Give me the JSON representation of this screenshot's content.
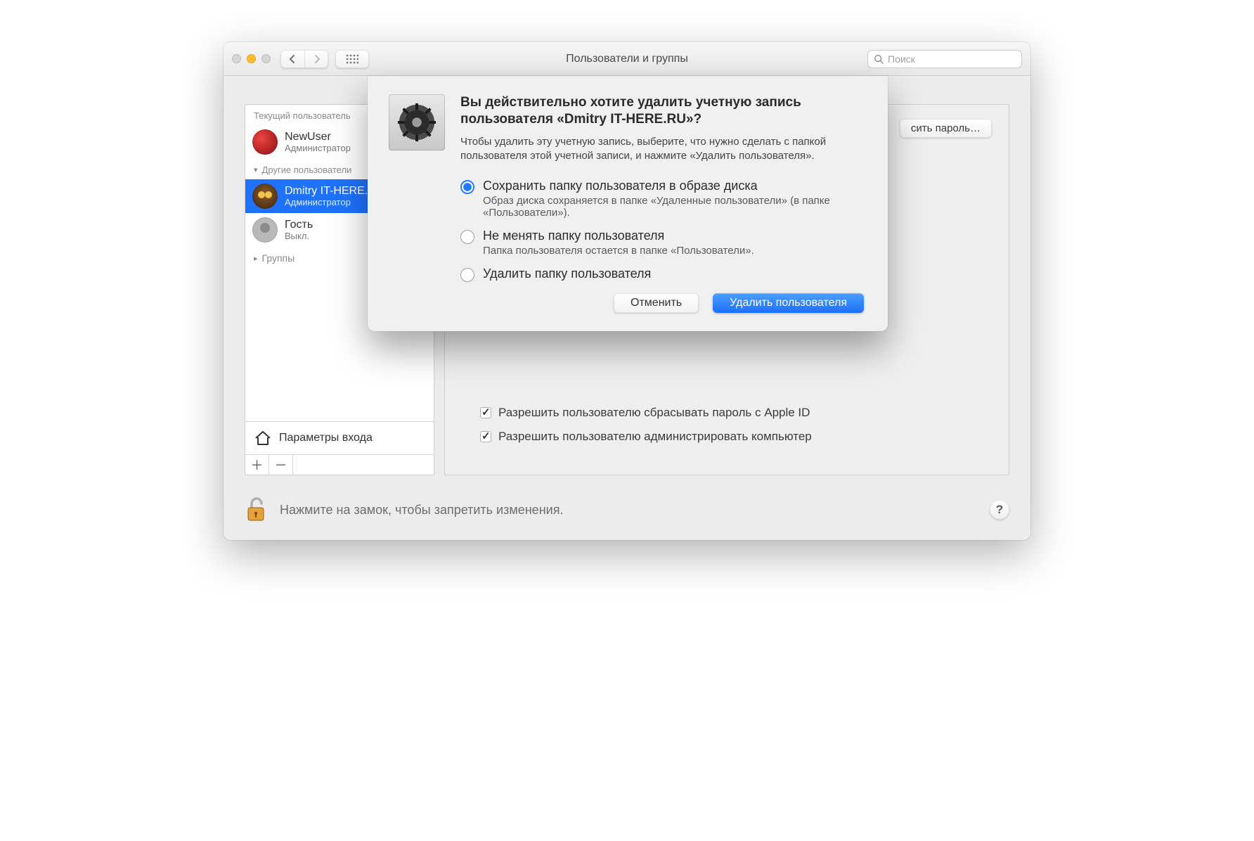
{
  "window": {
    "title": "Пользователи и группы"
  },
  "search": {
    "placeholder": "Поиск"
  },
  "sidebar": {
    "current_header": "Текущий пользователь",
    "others_header": "Другие пользователи",
    "groups_header": "Группы",
    "login_options": "Параметры входа",
    "users": [
      {
        "name": "NewUser",
        "role": "Администратор"
      },
      {
        "name": "Dmitry IT-HERE.RU",
        "role": "Администратор"
      },
      {
        "name": "Гость",
        "role": "Выкл."
      }
    ]
  },
  "main": {
    "reset_password_button": "сить пароль…",
    "checks": [
      "Разрешить пользователю сбрасывать пароль с Apple ID",
      "Разрешить пользователю администрировать компьютер"
    ]
  },
  "lock_hint": "Нажмите на замок, чтобы запретить изменения.",
  "help": "?",
  "dialog": {
    "title": "Вы действительно хотите удалить учетную запись пользователя «Dmitry IT-HERE.RU»?",
    "desc": "Чтобы удалить эту учетную запись, выберите, что нужно сделать с папкой пользователя этой учетной записи, и нажмите «Удалить пользователя».",
    "options": [
      {
        "label": "Сохранить папку пользователя в образе диска",
        "sub": "Образ диска сохраняется в папке «Удаленные пользователи» (в папке «Пользователи»)."
      },
      {
        "label": "Не менять папку пользователя",
        "sub": "Папка пользователя остается в папке «Пользователи»."
      },
      {
        "label": "Удалить папку пользователя",
        "sub": ""
      }
    ],
    "cancel": "Отменить",
    "confirm": "Удалить пользователя"
  }
}
